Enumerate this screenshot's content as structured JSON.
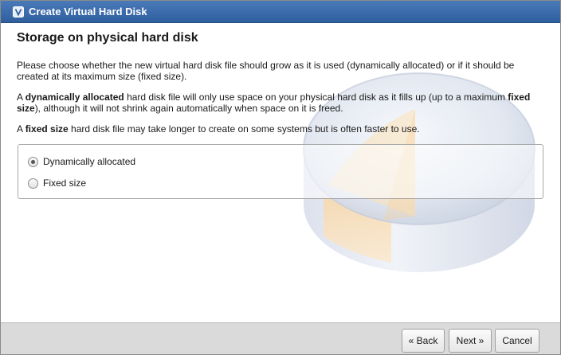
{
  "window": {
    "title": "Create Virtual Hard Disk",
    "title_icon": "virtualbox-icon"
  },
  "page": {
    "heading": "Storage on physical hard disk",
    "paragraph1": "Please choose whether the new virtual hard disk file should grow as it is used (dynamically allocated) or if it should be created at its maximum size (fixed size).",
    "paragraph2": {
      "part1": "A ",
      "bold1": "dynamically allocated",
      "part2": " hard disk file will only use space on your physical hard disk as it fills up (up to a maximum ",
      "bold2": "fixed size",
      "part3": "), although it will not shrink again automatically when space on it is freed."
    },
    "paragraph3": {
      "part1": "A ",
      "bold1": "fixed size",
      "part2": " hard disk file may take longer to create on some systems but is often faster to use."
    }
  },
  "options": [
    {
      "label": "Dynamically allocated",
      "checked": true
    },
    {
      "label": "Fixed size",
      "checked": false
    }
  ],
  "buttons": {
    "back": "« Back",
    "next": "Next »",
    "cancel": "Cancel"
  },
  "colors": {
    "titlebar": "#3a6aa8",
    "button_bar": "#dadada"
  }
}
